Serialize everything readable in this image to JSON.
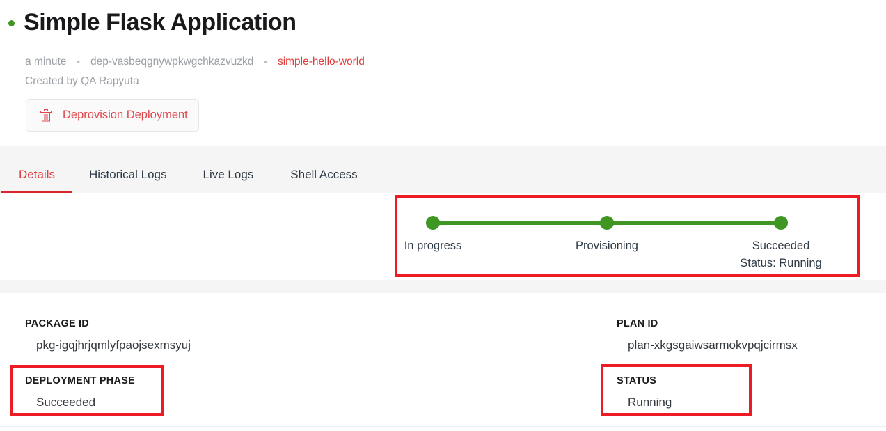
{
  "header": {
    "status_dot_color": "#3f9622",
    "title": "Simple Flask Application",
    "meta": {
      "age": "a minute",
      "deployment_id": "dep-vasbeqgnywpkwgchkazvuzkd",
      "package_link": "simple-hello-world",
      "separator": "•"
    },
    "created_by": "Created by QA Rapyuta",
    "deprovision_button": {
      "label": "Deprovision Deployment",
      "icon": "trash-icon",
      "color": "#e0474c"
    }
  },
  "tabs": [
    {
      "label": "Details",
      "active": true
    },
    {
      "label": "Historical Logs",
      "active": false
    },
    {
      "label": "Live Logs",
      "active": false
    },
    {
      "label": "Shell Access",
      "active": false
    }
  ],
  "stepper": {
    "accent_color": "#3f9622",
    "steps": [
      {
        "label": "In progress",
        "sub": "",
        "complete": true
      },
      {
        "label": "Provisioning",
        "sub": "",
        "complete": true
      },
      {
        "label": "Succeeded",
        "sub": "Status: Running",
        "complete": true
      }
    ]
  },
  "details": {
    "package_id": {
      "label": "PACKAGE ID",
      "value": "pkg-igqjhrjqmlyfpaojsexmsyuj"
    },
    "plan_id": {
      "label": "PLAN ID",
      "value": "plan-xkgsgaiwsarmokvpqjcirmsx"
    },
    "deployment_phase": {
      "label": "DEPLOYMENT PHASE",
      "value": "Succeeded"
    },
    "status": {
      "label": "STATUS",
      "value": "Running"
    }
  },
  "annotations": {
    "color": "#ed1c24",
    "boxes": [
      "stepper",
      "deployment-phase",
      "status"
    ]
  }
}
